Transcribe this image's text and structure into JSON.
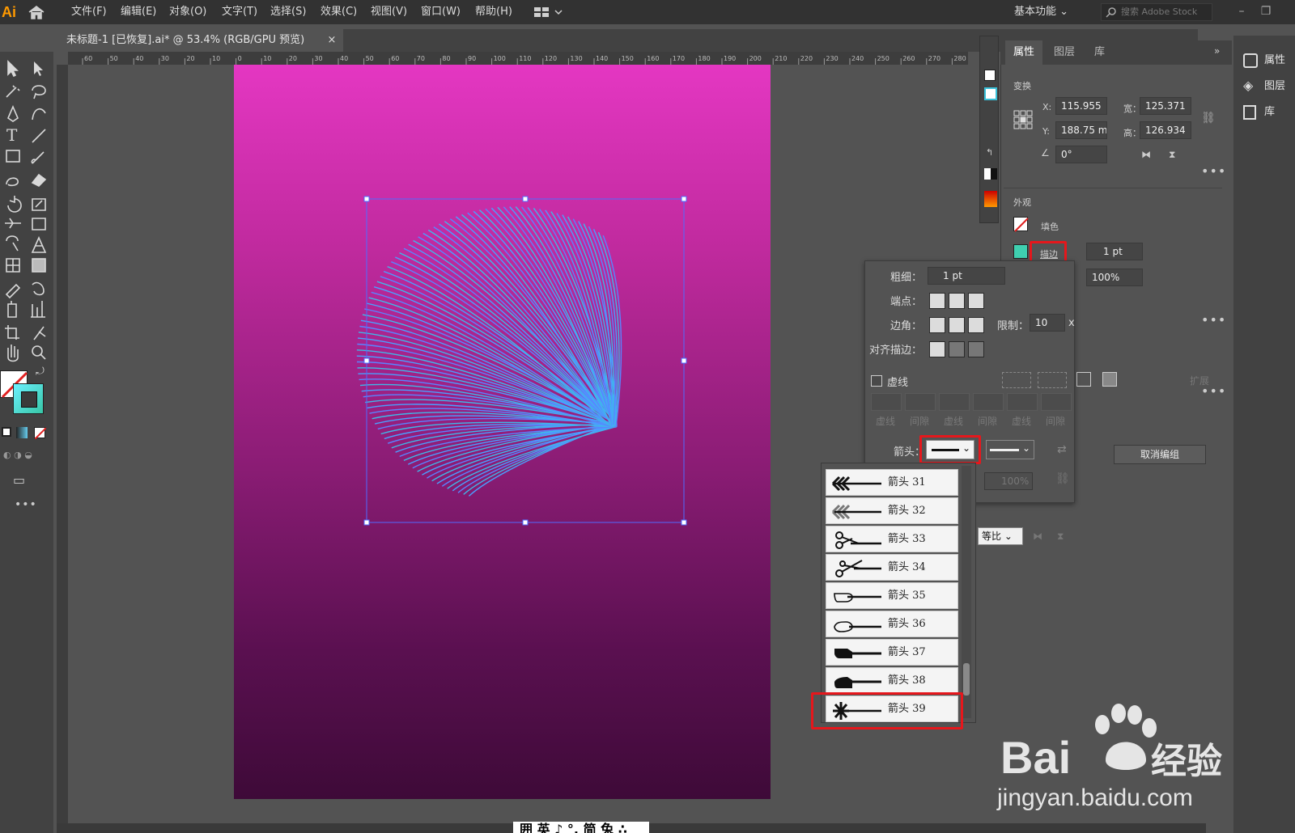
{
  "app": {
    "logo": "Ai",
    "menu": [
      "文件(F)",
      "编辑(E)",
      "对象(O)",
      "文字(T)",
      "选择(S)",
      "效果(C)",
      "视图(V)",
      "窗口(W)",
      "帮助(H)"
    ],
    "workspace": "基本功能",
    "stock_search_placeholder": "搜索 Adobe Stock"
  },
  "document": {
    "tab_title": "未标题-1 [已恢复].ai* @ 53.4% (RGB/GPU 预览)",
    "close": "×"
  },
  "ruler_top_labels": [
    "60",
    "50",
    "40",
    "30",
    "20",
    "10",
    "0",
    "10",
    "20",
    "30",
    "40",
    "50",
    "60",
    "70",
    "80",
    "90",
    "100",
    "110",
    "120",
    "130",
    "140",
    "150",
    "160",
    "170",
    "180",
    "190",
    "200",
    "210",
    "220",
    "230",
    "240",
    "250",
    "260",
    "270",
    "280"
  ],
  "properties": {
    "tabs": [
      "属性",
      "图层",
      "库"
    ],
    "transform_title": "变换",
    "x_label": "X:",
    "x_value": "115.955",
    "y_label": "Y:",
    "y_value": "188.75 m",
    "w_label": "宽：",
    "w_value": "125.371",
    "h_label": "高：",
    "h_value": "126.934",
    "angle_value": "0°",
    "appearance_title": "外观",
    "fill_label": "填色",
    "stroke_label": "描边",
    "stroke_weight": "1 pt",
    "opacity": "100%",
    "ungroup_button": "取消编组",
    "expand_label": "扩展",
    "more": "•••"
  },
  "dock": {
    "items": [
      "属性",
      "图层",
      "库"
    ]
  },
  "stroke_panel": {
    "weight_label": "粗细：",
    "weight_value": "1 pt",
    "cap_label": "端点：",
    "corner_label": "边角：",
    "limit_label": "限制：",
    "limit_value": "10",
    "limit_unit": "x",
    "align_label": "对齐描边：",
    "dashed_label": "虚线",
    "dash_labels": [
      "虚线",
      "间隙",
      "虚线",
      "间隙",
      "虚线",
      "间隙"
    ],
    "arrow_label": "箭头：",
    "scale_value": "100%",
    "align_option": "等比"
  },
  "arrowheads": [
    {
      "label": "箭头 31",
      "icon": "arrow-fletch-icon"
    },
    {
      "label": "箭头 32",
      "icon": "arrow-fletch-gray-icon"
    },
    {
      "label": "箭头 33",
      "icon": "scissors-icon"
    },
    {
      "label": "箭头 34",
      "icon": "scissors-open-icon"
    },
    {
      "label": "箭头 35",
      "icon": "hand-pointer-icon"
    },
    {
      "label": "箭头 36",
      "icon": "hand-pointer-outline-icon"
    },
    {
      "label": "箭头 37",
      "icon": "hand-pointer-black-icon"
    },
    {
      "label": "箭头 38",
      "icon": "hand-pointer-black2-icon"
    },
    {
      "label": "箭头 39",
      "icon": "asterisk-icon"
    }
  ],
  "statusbar": {
    "ime": "囲 英 ♪ °, 简 兔 ∴"
  },
  "watermark": {
    "brand": "Bai经验",
    "url": "jingyan.baidu.com"
  },
  "colors": {
    "highlight": "#e6171c",
    "artboard_top": "#e437c2",
    "artboard_bottom": "#3e0a38",
    "strokes": "#4a8cff"
  }
}
